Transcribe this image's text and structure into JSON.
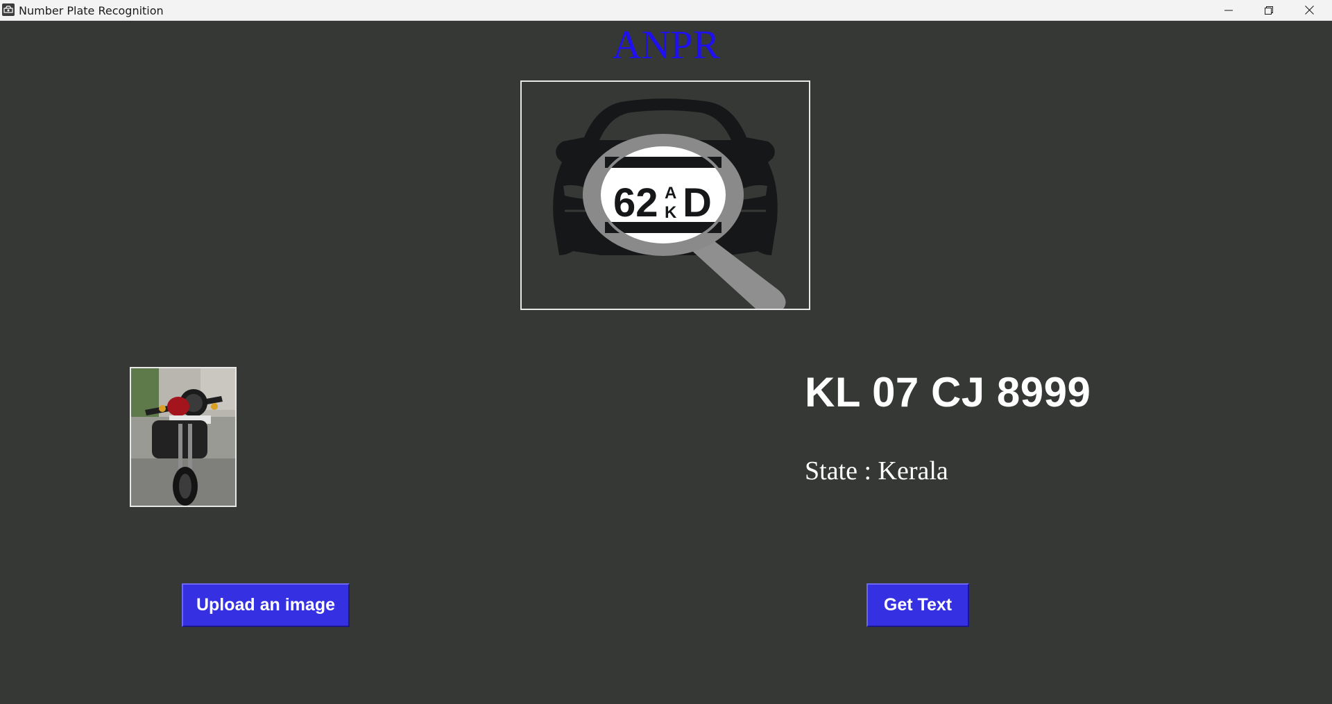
{
  "window": {
    "title": "Number Plate Recognition",
    "icons": {
      "app": "app-icon",
      "minimize": "minimize-icon",
      "maximize": "restore-icon",
      "close": "close-icon"
    }
  },
  "header": {
    "title": "ANPR"
  },
  "logo": {
    "plate_main": "62",
    "plate_small_top": "A",
    "plate_small_bottom": "K",
    "plate_end": "D"
  },
  "result": {
    "plate": "KL 07 CJ 8999",
    "state": "State : Kerala"
  },
  "buttons": {
    "upload_label": "Upload an image",
    "get_text_label": "Get Text"
  },
  "colors": {
    "background": "#353835",
    "heading": "#1f10f2",
    "button": "#3630e3",
    "text": "#ffffff"
  }
}
